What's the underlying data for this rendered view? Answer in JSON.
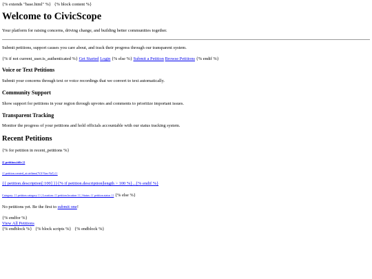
{
  "template": {
    "extends": "{% extends \"base.html\" %}",
    "block_content": "{% block content %}"
  },
  "hero": {
    "title": "Welcome to CivicScope",
    "tagline": "Your platform for raising concerns, driving change, and building better communities together."
  },
  "intro_text": "Submit petitions, support causes you care about, and track their progress through our transparent system.",
  "auth": {
    "if_tag": "{% if not current_user.is_authenticated %}",
    "get_started": "Get Started",
    "login": "Login",
    "else_tag": "{% else %}",
    "submit_petition": "Submit a Petition",
    "browse_petitions": "Browse Petitions",
    "endif_tag": "{% endif %}"
  },
  "features": [
    {
      "title": "Voice or Text Petitions",
      "desc": "Submit your concerns through text or voice recordings that we convert to text automatically."
    },
    {
      "title": "Community Support",
      "desc": "Show support for petitions in your region through upvotes and comments to prioritize important issues."
    },
    {
      "title": "Transparent Tracking",
      "desc": "Monitor the progress of your petitions and hold officials accountable with our status tracking system."
    }
  ],
  "recent": {
    "heading": "Recent Petitions",
    "for_tag": "{% for petition in recent_petitions %}",
    "petition_title": "{{ petition.title }}",
    "created_at": "{{ petition.created_at.strftime('%Y-%m-%d') }}",
    "description": "{{ petition.description[:100] }}{% if petition.description|length > 100 %}...{% endif %}",
    "meta": "Category: {{ petition.category }} | Location: {{ petition.location }} | Status: {{ petition.status }}",
    "else_tag": "{% else %}",
    "no_petitions_prefix": "No petitions yet. Be the first to ",
    "submit_one": "submit one",
    "no_petitions_suffix": "!",
    "endfor_tag": "{% endfor %}",
    "view_all": "View All Petitions"
  },
  "footer_tags": {
    "endblock": "{% endblock %}",
    "block_scripts": "{% block scripts %}",
    "endblock2": "{% endblock %}"
  },
  "colors": {
    "link": "#0000ee",
    "text": "#000000",
    "rule": "#999999"
  }
}
